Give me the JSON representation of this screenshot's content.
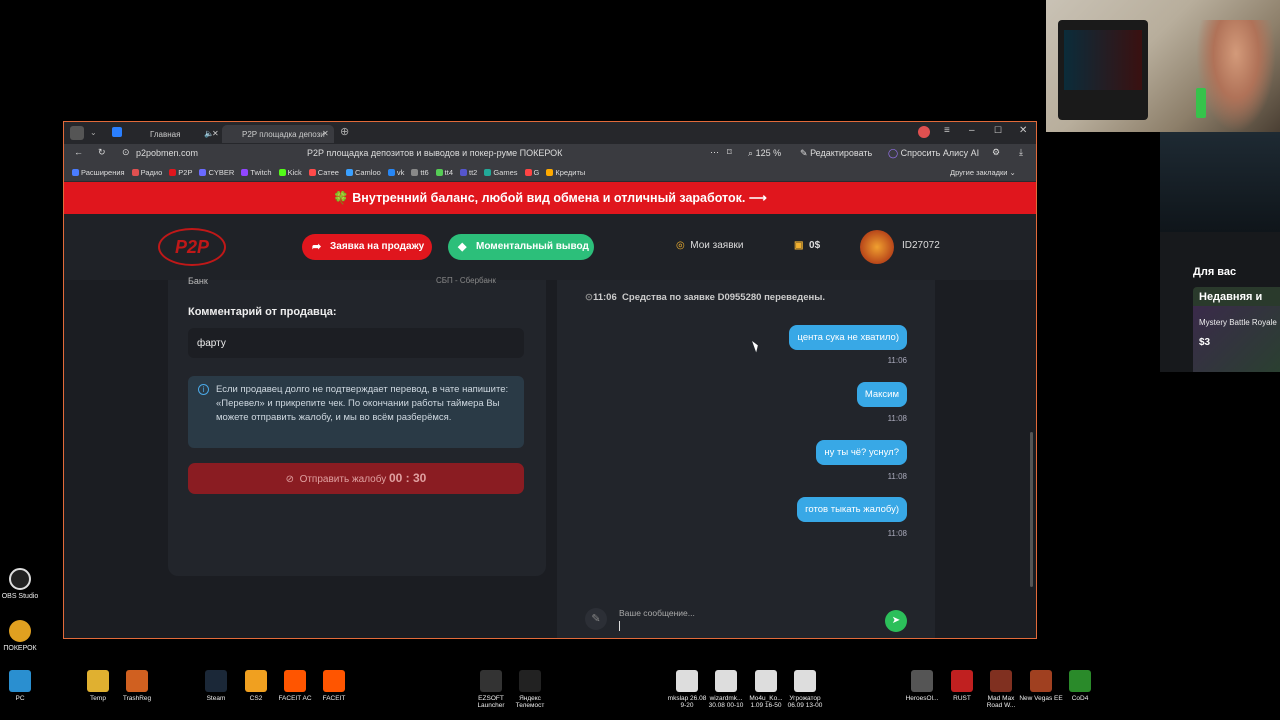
{
  "desktop": {
    "left_icons": [
      {
        "label": "OBS Studio",
        "icon": "obs-icon"
      },
      {
        "label": "ПОКЕРОК",
        "icon": "pokerok-icon"
      }
    ]
  },
  "store_panel": {
    "for_you": "Для вас",
    "recent": "Недавняя и",
    "card_title": "Mystery Battle Royale",
    "card_price": "$3"
  },
  "browser": {
    "tabs": [
      {
        "label": "Главная"
      },
      {
        "label": "P2P площадка депози"
      }
    ],
    "url": "p2pobmen.com",
    "page_title": "P2P площадка депозитов и выводов и покер-руме ПОКЕРОК",
    "zoom": "125 %",
    "edit_label": "Редактировать",
    "alice_label": "Спросить Алису AI",
    "bookmarks": [
      {
        "label": "Расширения",
        "color": "#4a7cff"
      },
      {
        "label": "Радио",
        "color": "#e05050"
      },
      {
        "label": "P2P",
        "color": "#e0161d"
      },
      {
        "label": "CYBER",
        "color": "#6a6aff"
      },
      {
        "label": "Twitch",
        "color": "#9146ff"
      },
      {
        "label": "Kick",
        "color": "#53fc18"
      },
      {
        "label": "Сатее",
        "color": "#ff4a4a"
      },
      {
        "label": "Camloo",
        "color": "#3aa0ff"
      },
      {
        "label": "vk",
        "color": "#2787f5"
      },
      {
        "label": "tt6",
        "color": "#888"
      },
      {
        "label": "tt4",
        "color": "#5c5"
      },
      {
        "label": "tt2",
        "color": "#55c"
      },
      {
        "label": "Games",
        "color": "#2a9"
      },
      {
        "label": "G",
        "color": "#f44"
      },
      {
        "label": "Кредиты",
        "color": "#fa0"
      }
    ],
    "other_bookmarks": "Другие закладки"
  },
  "site": {
    "promo": "Внутренний баланс, любой вид обмена и отличный заработок.",
    "logo": "P2P",
    "sell_button": "Заявка на продажу",
    "withdraw_button": "Моментальный вывод",
    "my_orders": "Мои заявки",
    "balance": "0$",
    "user_id": "ID27072"
  },
  "order": {
    "bank_label": "Банк",
    "bank_value": "СБП - Сбербанк",
    "comment_title": "Комментарий от продавца:",
    "comment_value": "фарту",
    "info_text": "Если продавец долго не подтверждает перевод, в чате напишите: «Перевел» и прикрепите чек. По окончании работы таймера Вы можете отправить жалобу, и мы во всём разберёмся.",
    "complaint_button": "Отправить жалобу",
    "complaint_timer": "00 : 30"
  },
  "chat": {
    "system_time": "11:06",
    "system_message": "Средства по заявке D0955280 переведены.",
    "messages": [
      {
        "text": "цента сука не хватило)",
        "time": "11:06"
      },
      {
        "text": "Максим",
        "time": "11:08"
      },
      {
        "text": "ну ты чё? уснул?",
        "time": "11:08"
      },
      {
        "text": "готов тыкать жалобу)",
        "time": "11:08"
      }
    ],
    "input_placeholder": "Ваше сообщение..."
  },
  "taskbar": [
    {
      "label": "PC"
    },
    {
      "label": "Temp"
    },
    {
      "label": "TrashReg"
    },
    {
      "label": "Steam"
    },
    {
      "label": "CS2"
    },
    {
      "label": "FACEIT AC"
    },
    {
      "label": "FACEIT"
    },
    {
      "label": "EZSOFT Launcher"
    },
    {
      "label": "Яндекс Телемост"
    },
    {
      "label": "mkslap 26.08 9-20"
    },
    {
      "label": "wizardmk... 30.08 00-10"
    },
    {
      "label": "Mo4u_Ko... 1.09 16-50"
    },
    {
      "label": "Угрожатор 06.09 13-00"
    },
    {
      "label": "HeroesOl..."
    },
    {
      "label": "RUST"
    },
    {
      "label": "Mad Max Road W..."
    },
    {
      "label": "New Vegas EE"
    },
    {
      "label": "CoD4"
    }
  ]
}
